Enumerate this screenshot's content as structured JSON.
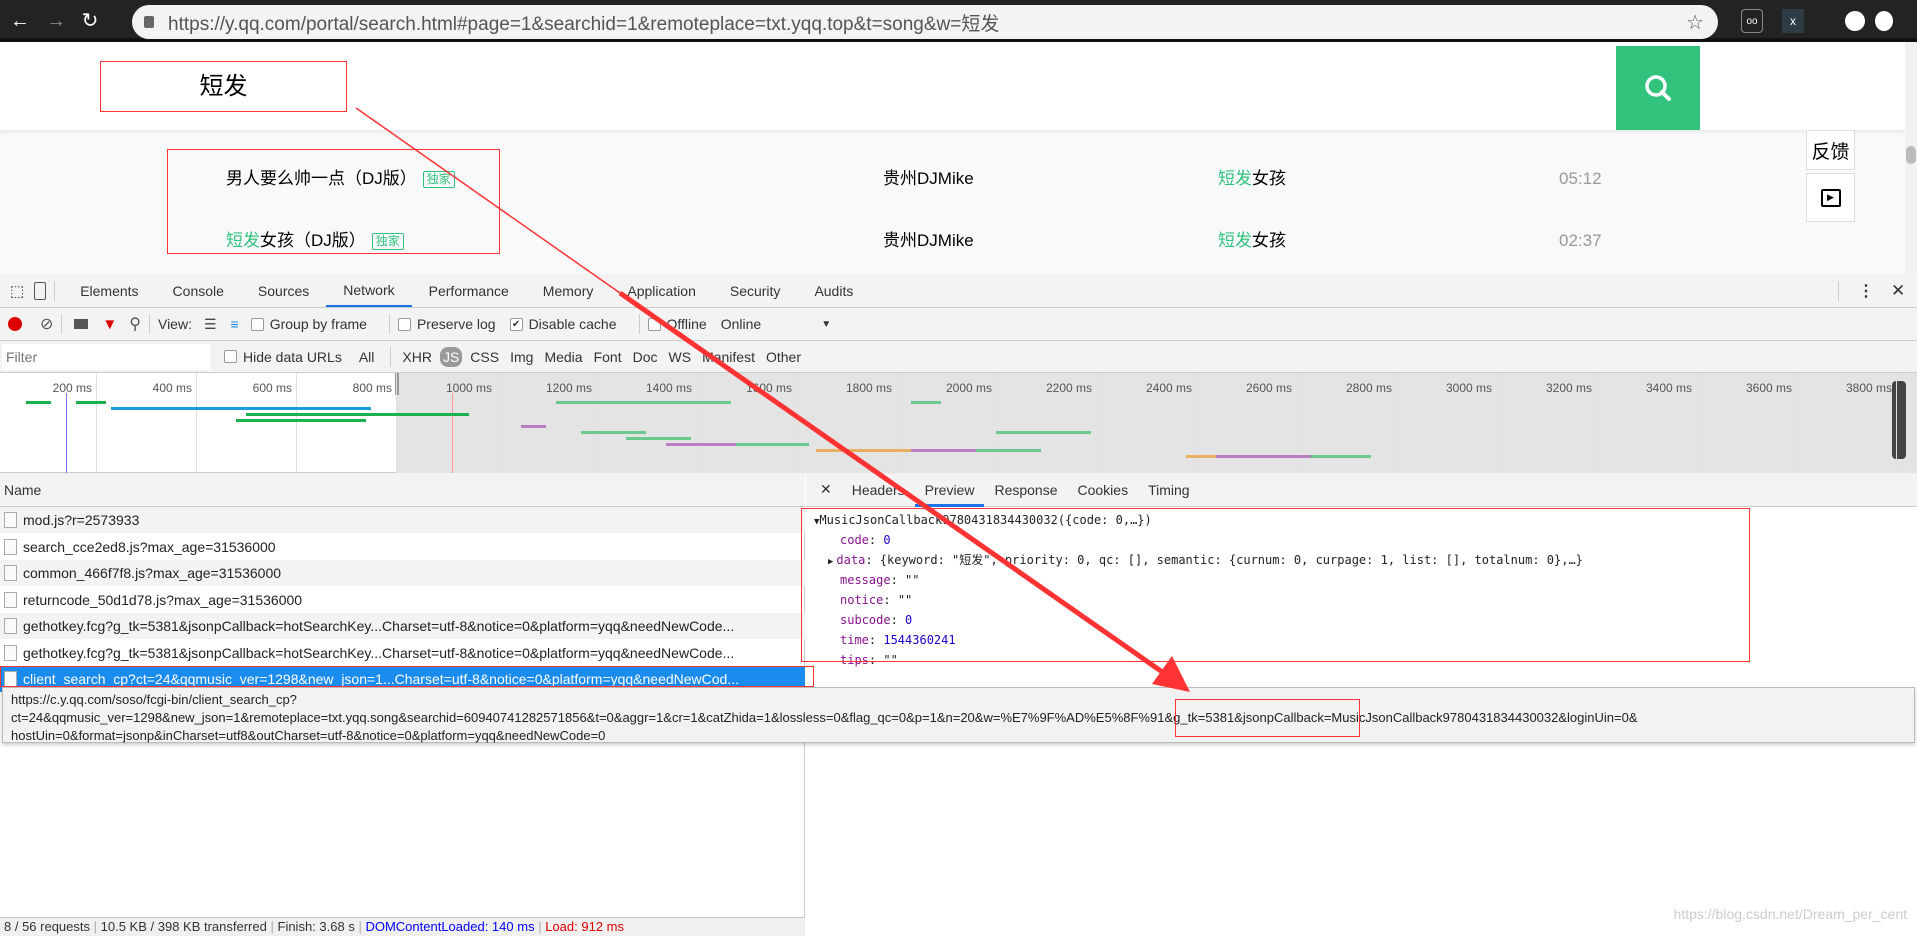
{
  "browser": {
    "url": "https://y.qq.com/portal/search.html#page=1&searchid=1&remoteplace=txt.yqq.top&t=song&w=短发"
  },
  "page": {
    "search_value": "短发",
    "results": [
      {
        "title_prefix": "",
        "title_rest": "男人要么帅一点（DJ版）",
        "badge": "独家",
        "artist": "贵州DJMike",
        "album_hl": "短发",
        "album_rest": "女孩",
        "duration": "05:12"
      },
      {
        "title_prefix": "短发",
        "title_rest": "女孩（DJ版）",
        "badge": "独家",
        "artist": "贵州DJMike",
        "album_hl": "短发",
        "album_rest": "女孩",
        "duration": "02:37"
      }
    ],
    "feedback_label": "反馈"
  },
  "devtools": {
    "tabs": [
      "Elements",
      "Console",
      "Sources",
      "Network",
      "Performance",
      "Memory",
      "Application",
      "Security",
      "Audits"
    ],
    "active_tab": "Network",
    "toolbar": {
      "view_label": "View:",
      "group_by_frame": "Group by frame",
      "preserve_log": "Preserve log",
      "disable_cache": "Disable cache",
      "disable_cache_checked": true,
      "offline": "Offline",
      "throttle": "Online"
    },
    "filter": {
      "placeholder": "Filter",
      "hide_data_urls": "Hide data URLs",
      "types": [
        "All",
        "XHR",
        "JS",
        "CSS",
        "Img",
        "Media",
        "Font",
        "Doc",
        "WS",
        "Manifest",
        "Other"
      ],
      "active_type": "JS"
    },
    "timeline": {
      "ticks": [
        "200 ms",
        "400 ms",
        "600 ms",
        "800 ms",
        "1000 ms",
        "1200 ms",
        "1400 ms",
        "1600 ms",
        "1800 ms",
        "2000 ms",
        "2200 ms",
        "2400 ms",
        "2600 ms",
        "2800 ms",
        "3000 ms",
        "3200 ms",
        "3400 ms",
        "3600 ms",
        "3800 ms"
      ],
      "bars": [
        {
          "start": 60,
          "end": 110,
          "lane": 1,
          "color": "#1bb14c"
        },
        {
          "start": 160,
          "end": 220,
          "lane": 1,
          "color": "#1bb14c"
        },
        {
          "start": 230,
          "end": 750,
          "lane": 2,
          "color": "#1a9bdc"
        },
        {
          "start": 500,
          "end": 945,
          "lane": 3,
          "color": "#1bb14c"
        },
        {
          "start": 480,
          "end": 740,
          "lane": 4,
          "color": "#1bb14c"
        },
        {
          "start": 1120,
          "end": 1470,
          "lane": 1,
          "color": "#6cc98e"
        },
        {
          "start": 1830,
          "end": 1890,
          "lane": 1,
          "color": "#6cc98e"
        },
        {
          "start": 1050,
          "end": 1100,
          "lane": 5,
          "color": "#b880c0"
        },
        {
          "start": 1170,
          "end": 1300,
          "lane": 6,
          "color": "#6cc98e"
        },
        {
          "start": 1260,
          "end": 1390,
          "lane": 7,
          "color": "#6cc98e"
        },
        {
          "start": 1340,
          "end": 1480,
          "lane": 8,
          "color": "#b880c0"
        },
        {
          "start": 1480,
          "end": 1625,
          "lane": 8,
          "color": "#6cc98e"
        },
        {
          "start": 1640,
          "end": 1830,
          "lane": 9,
          "color": "#e8b060"
        },
        {
          "start": 1830,
          "end": 1960,
          "lane": 9,
          "color": "#b880c0"
        },
        {
          "start": 1960,
          "end": 2090,
          "lane": 9,
          "color": "#6cc98e"
        },
        {
          "start": 2000,
          "end": 2190,
          "lane": 6,
          "color": "#6cc98e"
        },
        {
          "start": 2380,
          "end": 2440,
          "lane": 10,
          "color": "#e8b060"
        },
        {
          "start": 2440,
          "end": 2630,
          "lane": 10,
          "color": "#b880c0"
        },
        {
          "start": 2630,
          "end": 2750,
          "lane": 10,
          "color": "#6cc98e"
        }
      ]
    },
    "name_header": "Name",
    "requests": [
      "mod.js?r=2573933",
      "search_cce2ed8.js?max_age=31536000",
      "common_466f7f8.js?max_age=31536000",
      "returncode_50d1d78.js?max_age=31536000",
      "gethotkey.fcg?g_tk=5381&jsonpCallback=hotSearchKey...Charset=utf-8&notice=0&platform=yqq&needNewCode...",
      "gethotkey.fcg?g_tk=5381&jsonpCallback=hotSearchKey...Charset=utf-8&notice=0&platform=yqq&needNewCode...",
      "client_search_cp?ct=24&qqmusic_ver=1298&new_json=1...Charset=utf-8&notice=0&platform=yqq&needNewCod..."
    ],
    "tooltip": {
      "line1": "https://c.y.qq.com/soso/fcgi-bin/client_search_cp?",
      "line2_pre": "ct=24&qqmusic_ver=1298&new_json=1&remoteplace=txt.yqq.song&searchid=60940741282571856&t=0&aggr=1&cr=1&catZhida=1&lossless=0&flag_qc=0&p=1&n=20&w=",
      "line2_hl": "%E7%9F%AD%E5%8F%91",
      "line2_post": "&g_tk=5381&jsonpCallback=MusicJsonCallback9780431834430032&loginUin=0&",
      "line3": "hostUin=0&format=jsonp&inCharset=utf8&outCharset=utf-8&notice=0&platform=yqq&needNewCode=0"
    },
    "status": {
      "requests": "8 / 56 requests",
      "transferred": "10.5 KB / 398 KB transferred",
      "finish": "Finish: 3.68 s",
      "dcl": "DOMContentLoaded: 140 ms",
      "load": "Load: 912 ms"
    },
    "detail_tabs": [
      "Headers",
      "Preview",
      "Response",
      "Cookies",
      "Timing"
    ],
    "active_detail_tab": "Preview",
    "preview": {
      "root": "MusicJsonCallback9780431834430032({code: 0,…})",
      "lines": [
        {
          "key": "code",
          "value": "0",
          "num": true
        },
        {
          "key": "data",
          "value": "{keyword: \"短发\", priority: 0, qc: [], semantic: {curnum: 0, curpage: 1, list: [], totalnum: 0},…}",
          "expandable": true
        },
        {
          "key": "message",
          "value": "\"\""
        },
        {
          "key": "notice",
          "value": "\"\""
        },
        {
          "key": "subcode",
          "value": "0",
          "num": true
        },
        {
          "key": "time",
          "value": "1544360241",
          "num": true
        },
        {
          "key": "tips",
          "value": "\"\""
        }
      ]
    }
  },
  "watermark": "https://blog.csdn.net/Dream_per_cent",
  "colors": {
    "accent_green": "#31c27c",
    "annotation_red": "#f33",
    "devtools_blue": "#1a73e8"
  }
}
